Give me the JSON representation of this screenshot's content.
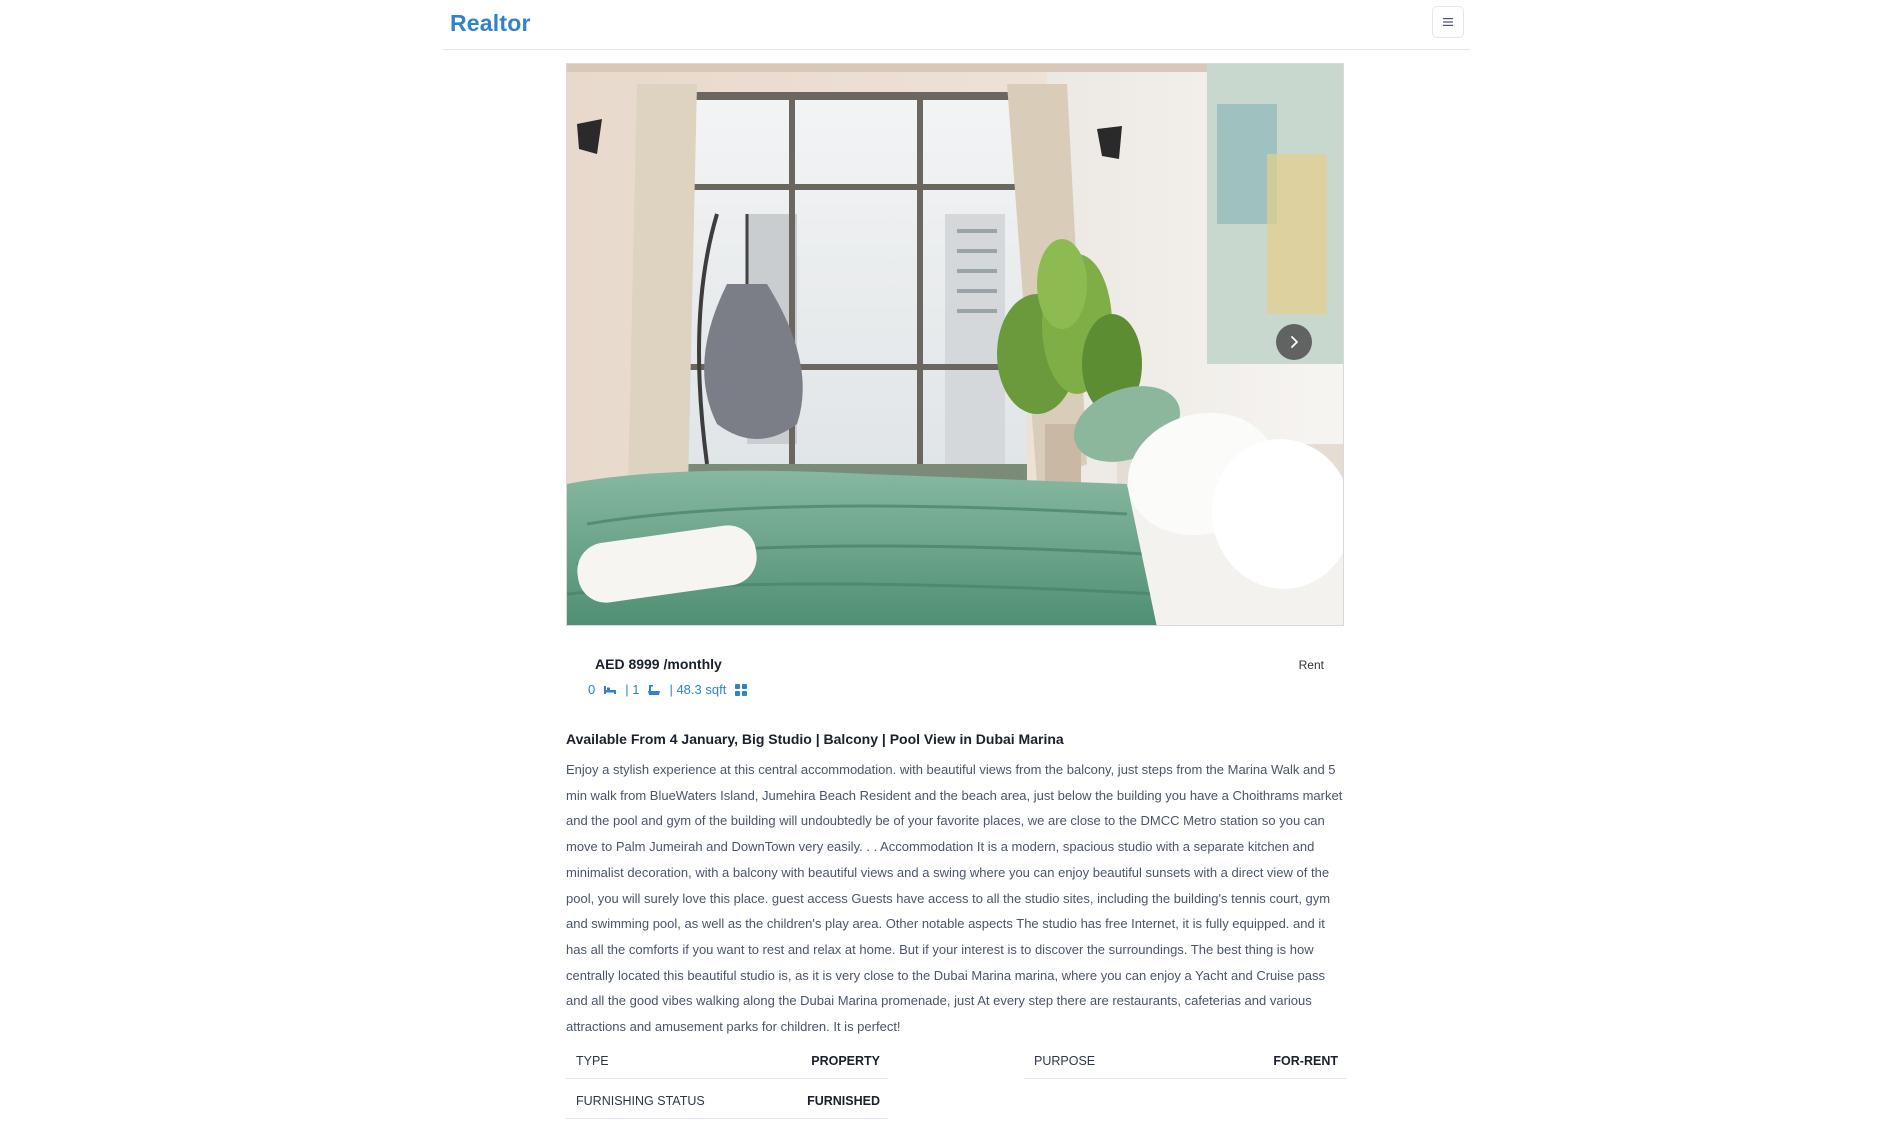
{
  "navbar": {
    "brand": "Realtor",
    "menu_icon": "hamburger-icon"
  },
  "gallery": {
    "image_alt": "Studio bedroom with green bedding, hanging swing chair and large window",
    "next_icon": "chevron-right-icon"
  },
  "listing": {
    "price": "AED 8999 /monthly",
    "badge": "Rent",
    "rooms": "0",
    "baths": "| 1",
    "area": "| 48.3 sqft",
    "title": "Available From 4 January, Big Studio | Balcony | Pool View in Dubai Marina",
    "description": "Enjoy a stylish experience at this central accommodation. with beautiful views from the balcony, just steps from the Marina Walk and 5 min walk from BlueWaters Island, Jumehira Beach Resident and the beach area, just below the building you have a Choithrams market and the pool and gym of the building will undoubtedly be of your favorite places, we are close to the DMCC Metro station so you can move to Palm Jumeirah and DownTown very easily. . . Accommodation It is a modern, spacious studio with a separate kitchen and minimalist decoration, with a balcony with beautiful views and a swing where you can enjoy beautiful sunsets with a direct view of the pool, you will surely love this place. guest access Guests have access to all the studio sites, including the building's tennis court, gym and swimming pool, as well as the children's play area. Other notable aspects The studio has free Internet, it is fully equipped. and it has all the comforts if you want to rest and relax at home. But if your interest is to discover the surroundings. The best thing is how centrally located this beautiful studio is, as it is very close to the Dubai Marina marina, where you can enjoy a Yacht and Cruise pass and all the good vibes walking along the Dubai Marina promenade, just At every step there are restaurants, cafeterias and various attractions and amusement parks for children. It is perfect!"
  },
  "details": {
    "type_label": "TYPE",
    "type_value": "PROPERTY",
    "purpose_label": "PURPOSE",
    "purpose_value": "FOR-RENT",
    "furnishing_label": "FURNISHING STATUS",
    "furnishing_value": "FURNISHED"
  },
  "colors": {
    "brand": "#3182ce",
    "text": "#1a202c",
    "muted": "#4a5568",
    "border": "#e2e8f0"
  }
}
